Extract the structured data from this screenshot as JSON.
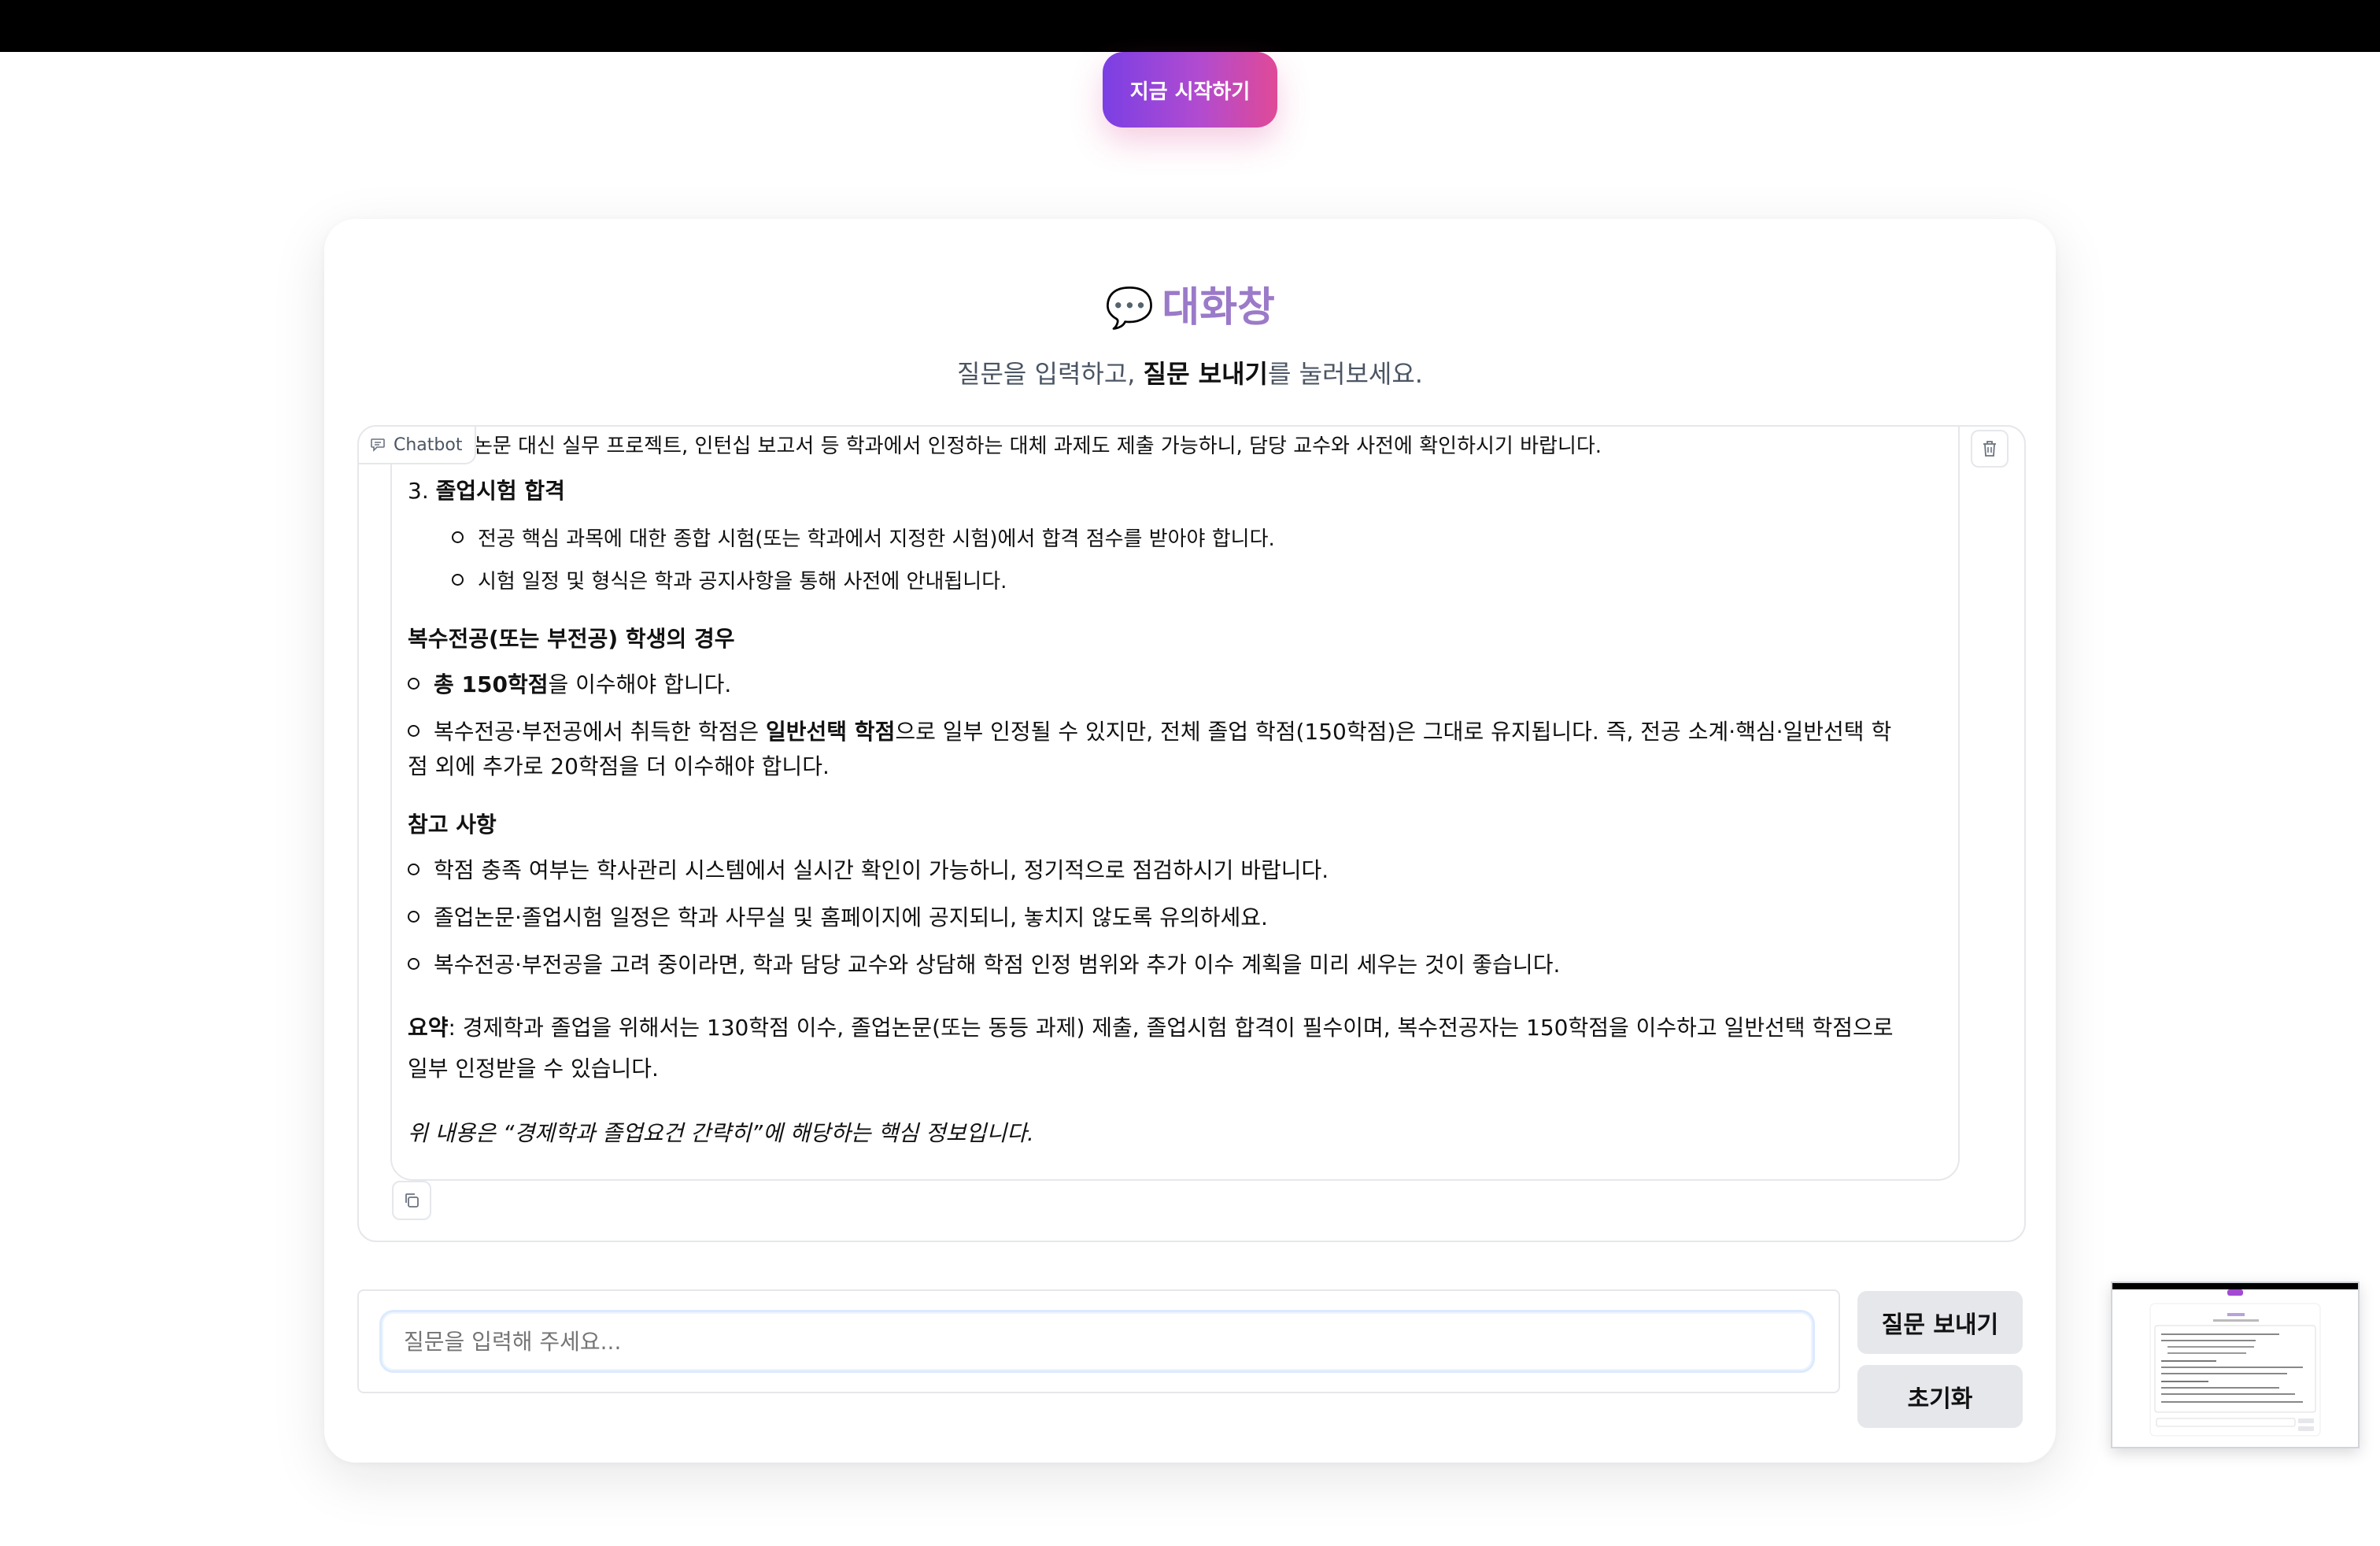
{
  "topbar": {},
  "hero": {
    "start_button": "지금 시작하기"
  },
  "card": {
    "title_icon": "speech-bubble-icon",
    "title": "대화창",
    "subtitle_pre": "질문을 입력하고, ",
    "subtitle_bold": "질문 보내기",
    "subtitle_post": "를 눌러보세요."
  },
  "chat": {
    "label": "Chatbot",
    "messages": {
      "line_top": "논문 대신 실무 프로젝트, 인턴십 보고서 등 학과에서 인정하는 대체 과제도 제출 가능하니, 담당 교수와 사전에 확인하시기 바랍니다.",
      "item3_num": "3. ",
      "item3_title": "졸업시험 합격",
      "item3_sub1": "전공 핵심 과목에 대한 종합 시험(또는 학과에서 지정한 시험)에서 합격 점수를 받아야 합니다.",
      "item3_sub2": "시험 일정 및 형식은 학과 공지사항을 통해 사전에 안내됩니다.",
      "double_heading": "복수전공(또는 부전공) 학생의 경우",
      "double_b1_bold": "총 150학점",
      "double_b1_rest": "을 이수해야 합니다.",
      "double_b2_pre": "복수전공·부전공에서 취득한 학점은 ",
      "double_b2_bold": "일반선택 학점",
      "double_b2_post": "으로 일부 인정될 수 있지만, 전체 졸업 학점(150학점)은 그대로 유지됩니다. 즉, 전공 소계·핵심·일반선택 학",
      "double_b2_line2": "점 외에 추가로 20학점을 더 이수해야 합니다.",
      "ref_heading": "참고 사항",
      "ref_b1": "학점 충족 여부는 학사관리 시스템에서 실시간 확인이 가능하니, 정기적으로 점검하시기 바랍니다.",
      "ref_b2": "졸업논문·졸업시험 일정은 학과 사무실 및 홈페이지에 공지되니, 놓치지 않도록 유의하세요.",
      "ref_b3": "복수전공·부전공을 고려 중이라면, 학과 담당 교수와 상담해 학점 인정 범위와 추가 이수 계획을 미리 세우는 것이 좋습니다.",
      "summary_label": "요약",
      "summary_line1": ": 경제학과 졸업을 위해서는 130학점 이수, 졸업논문(또는 동등 과제) 제출, 졸업시험 합격이 필수이며, 복수전공자는 150학점을 이수하고 일반선택 학점으로",
      "summary_line2": "일부 인정받을 수 있습니다.",
      "closing": "위 내용은 “경제학과 졸업요건 간략히”에 해당하는 핵심 정보입니다."
    }
  },
  "input": {
    "placeholder": "질문을 입력해 주세요..."
  },
  "buttons": {
    "send": "질문 보내기",
    "reset": "초기화"
  },
  "colors": {
    "accent_start": "#7b3fe4",
    "accent_end": "#e04a97",
    "title": "#9b7ac9"
  }
}
